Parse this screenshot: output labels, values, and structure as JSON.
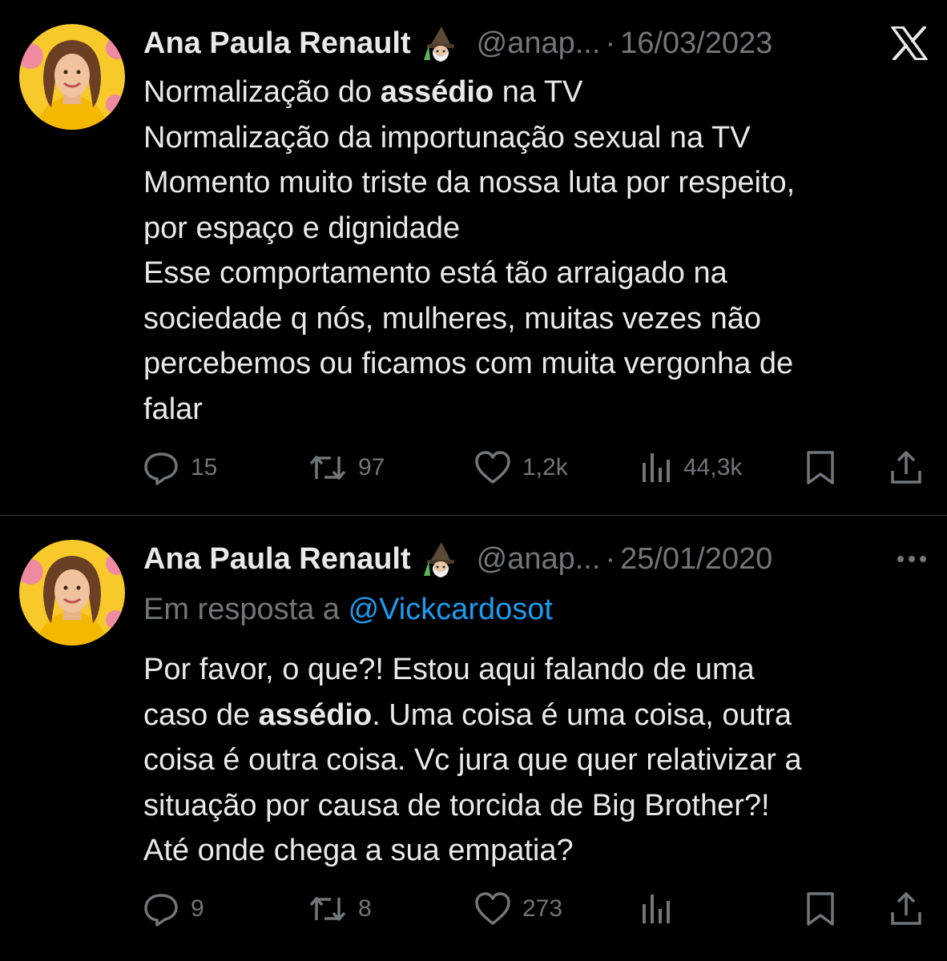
{
  "tweets": [
    {
      "author_name": "Ana Paula Renault",
      "author_handle": "@anap...",
      "separator": "·",
      "date": "16/03/2023",
      "header_icon": "x-logo-icon",
      "badge_icon": "witch-emoji-icon",
      "lines": [
        [
          "Normalização do ",
          "assédio",
          " na TV"
        ],
        [
          "Normalização da importunação sexual na TV"
        ],
        [
          "Momento muito triste da nossa luta por respeito,"
        ],
        [
          "por espaço e dignidade"
        ],
        [
          "Esse comportamento está tão arraigado na"
        ],
        [
          "sociedade q nós, mulheres, muitas vezes não"
        ],
        [
          "percebemos ou ficamos com muita vergonha de"
        ],
        [
          "falar"
        ]
      ],
      "stats": {
        "replies": "15",
        "retweets": "97",
        "likes": "1,2k",
        "views": "44,3k"
      }
    },
    {
      "author_name": "Ana Paula Renault",
      "author_handle": "@anap...",
      "separator": "·",
      "date": "25/01/2020",
      "header_icon": "more-options-icon",
      "badge_icon": "witch-emoji-icon",
      "reply_prefix": "Em resposta a ",
      "reply_mention": "@Vickcardosot",
      "lines": [
        [
          "Por favor, o que?! Estou aqui falando de uma"
        ],
        [
          "caso de ",
          "assédio",
          ". Uma coisa é uma coisa, outra"
        ],
        [
          "coisa é outra coisa. Vc jura que quer relativizar a"
        ],
        [
          "situação por causa de torcida de Big Brother?!"
        ],
        [
          "Até onde chega a sua empatia?"
        ]
      ],
      "stats": {
        "replies": "9",
        "retweets": "8",
        "likes": "273",
        "views": ""
      }
    }
  ],
  "colors": {
    "background": "#000000",
    "text": "#e7e9ea",
    "secondary": "#71767b",
    "link": "#1d9bf0",
    "divider": "#2f3336"
  }
}
